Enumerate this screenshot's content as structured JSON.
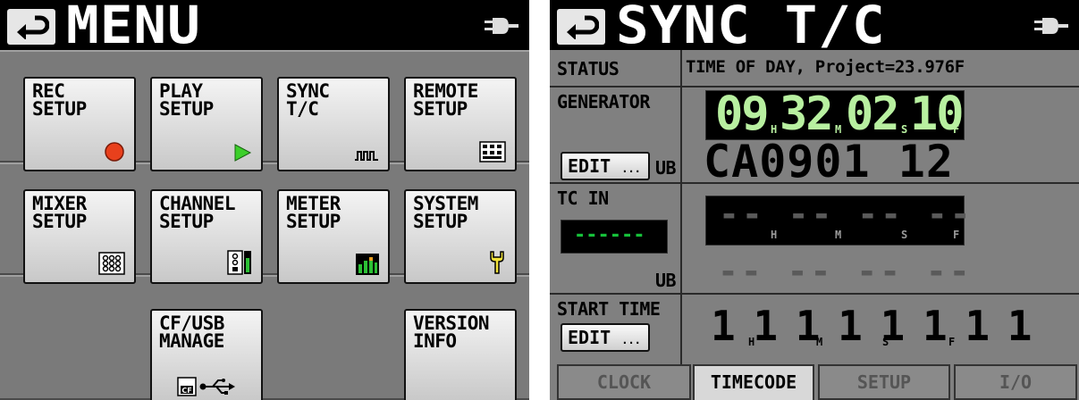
{
  "menu_screen": {
    "title": "MENU",
    "buttons": [
      {
        "label": "REC\nSETUP",
        "icon": "record-dot-icon"
      },
      {
        "label": "PLAY\nSETUP",
        "icon": "play-triangle-icon"
      },
      {
        "label": "SYNC\nT/C",
        "icon": "waveform-icon"
      },
      {
        "label": "REMOTE\nSETUP",
        "icon": "remote-keypad-icon"
      },
      {
        "label": "MIXER\nSETUP",
        "icon": "mixer-grid-icon"
      },
      {
        "label": "CHANNEL\nSETUP",
        "icon": "channel-strip-icon"
      },
      {
        "label": "METER\nSETUP",
        "icon": "meter-bars-icon"
      },
      {
        "label": "SYSTEM\nSETUP",
        "icon": "wrench-icon"
      },
      {
        "label": "CF/USB\nMANAGE",
        "icon": "cf-usb-icon"
      },
      {
        "label": "VERSION\nINFO",
        "icon": ""
      }
    ]
  },
  "sync_screen": {
    "title": "SYNC T/C",
    "status_label": "STATUS",
    "status_value": "TIME OF DAY, Project=23.976F",
    "generator_label": "GENERATOR",
    "generator_tc": {
      "h": "09",
      "m": "32",
      "s": "02",
      "f": "10"
    },
    "generator_ub": "CA0901 12",
    "edit_label": "EDIT",
    "edit_dots": "...",
    "ub_label": "UB",
    "tc_in_label": "TC IN",
    "tc_in_indicator": "------",
    "tc_in_empty": "-- -- -- --",
    "tc_in_ub_empty": "-- -- -- --",
    "start_time_label": "START TIME",
    "start_time_value": "1 1 1 1 1 1 1 1",
    "unit_h": "H",
    "unit_m": "M",
    "unit_s": "S",
    "unit_f": "F",
    "tabs": [
      "CLOCK",
      "TIMECODE",
      "SETUP",
      "I/O"
    ],
    "active_tab": "TIMECODE"
  },
  "colors": {
    "tc_green": "#b8f0a0",
    "signal_green": "#16c03a",
    "record_red": "#e8401c",
    "play_green": "#3ccf2a"
  }
}
